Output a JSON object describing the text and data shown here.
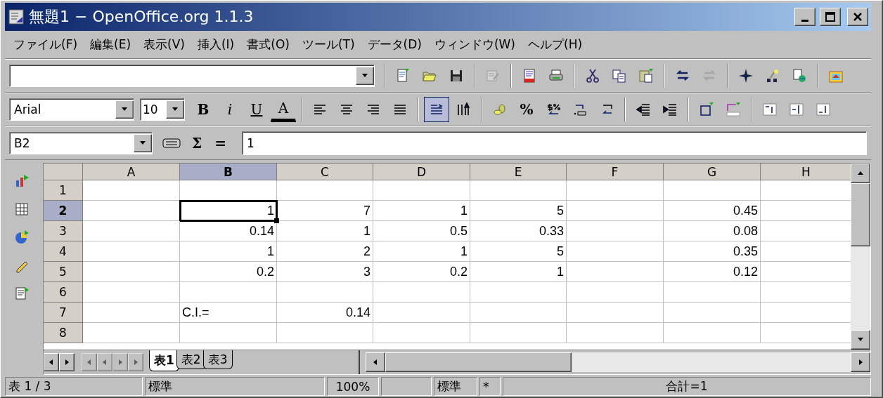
{
  "window": {
    "title": "無題1 − OpenOffice.org 1.1.3"
  },
  "menu": [
    {
      "label": "ファイル(F)"
    },
    {
      "label": "編集(E)"
    },
    {
      "label": "表示(V)"
    },
    {
      "label": "挿入(I)"
    },
    {
      "label": "書式(O)"
    },
    {
      "label": "ツール(T)"
    },
    {
      "label": "データ(D)"
    },
    {
      "label": "ウィンドウ(W)"
    },
    {
      "label": "ヘルプ(H)"
    }
  ],
  "standard_toolbar": {
    "items": [
      {
        "kind": "new-document",
        "disabled": false
      },
      {
        "kind": "open-folder",
        "disabled": false
      },
      {
        "kind": "floppy-disk",
        "disabled": false
      },
      {
        "kind": "separator"
      },
      {
        "kind": "edit-document",
        "disabled": true
      },
      {
        "kind": "separator"
      },
      {
        "kind": "pdf-document",
        "disabled": false
      },
      {
        "kind": "printer",
        "disabled": false
      },
      {
        "kind": "separator"
      },
      {
        "kind": "scissors",
        "disabled": false
      },
      {
        "kind": "copy",
        "disabled": false
      },
      {
        "kind": "paste",
        "disabled": false
      },
      {
        "kind": "separator"
      },
      {
        "kind": "undo-arrow",
        "disabled": false
      },
      {
        "kind": "redo-arrow",
        "disabled": true
      },
      {
        "kind": "separator"
      },
      {
        "kind": "compass-star",
        "disabled": false
      },
      {
        "kind": "stylist",
        "disabled": false
      },
      {
        "kind": "globe-document",
        "disabled": false
      },
      {
        "kind": "separator"
      },
      {
        "kind": "framed-picture",
        "disabled": false
      }
    ]
  },
  "format_toolbar": {
    "font": "Arial",
    "size": "10",
    "items": [
      {
        "kind": "bold",
        "glyph": "B",
        "pressed": false
      },
      {
        "kind": "italic",
        "glyph": "i",
        "pressed": false
      },
      {
        "kind": "underline",
        "glyph": "U",
        "pressed": false
      },
      {
        "kind": "font-color",
        "glyph": "A",
        "pressed": false
      },
      {
        "kind": "separator"
      },
      {
        "kind": "align-left",
        "pressed": false
      },
      {
        "kind": "align-center",
        "pressed": false
      },
      {
        "kind": "align-right",
        "pressed": false
      },
      {
        "kind": "justify",
        "pressed": false
      },
      {
        "kind": "separator"
      },
      {
        "kind": "wrap-text",
        "pressed": true
      },
      {
        "kind": "vertical-text",
        "pressed": false
      },
      {
        "kind": "separator"
      },
      {
        "kind": "coins",
        "pressed": false
      },
      {
        "kind": "percent",
        "glyph": "%",
        "pressed": false
      },
      {
        "kind": "currency-percent",
        "pressed": false
      },
      {
        "kind": "add-decimal",
        "pressed": false
      },
      {
        "kind": "remove-decimal",
        "pressed": false
      },
      {
        "kind": "separator"
      },
      {
        "kind": "outdent",
        "pressed": false
      },
      {
        "kind": "indent",
        "pressed": false
      },
      {
        "kind": "separator"
      },
      {
        "kind": "border",
        "pressed": false
      },
      {
        "kind": "fill-color",
        "pressed": false
      },
      {
        "kind": "separator"
      },
      {
        "kind": "align-top",
        "pressed": false
      },
      {
        "kind": "align-middle",
        "pressed": false
      },
      {
        "kind": "align-bottom",
        "pressed": false
      }
    ]
  },
  "formula_bar": {
    "name_box": "B2",
    "sum": "Σ",
    "equals": "=",
    "value": "1"
  },
  "side_toolbar": [
    {
      "kind": "chart-edit"
    },
    {
      "kind": "grid-table"
    },
    {
      "kind": "pie-chart"
    },
    {
      "kind": "pencil"
    },
    {
      "kind": "document-arrow"
    }
  ],
  "sheet": {
    "columns": [
      {
        "label": "A",
        "selected": false
      },
      {
        "label": "B",
        "selected": true
      },
      {
        "label": "C",
        "selected": false
      },
      {
        "label": "D",
        "selected": false
      },
      {
        "label": "E",
        "selected": false
      },
      {
        "label": "F",
        "selected": false
      },
      {
        "label": "G",
        "selected": false
      },
      {
        "label": "H",
        "selected": false
      }
    ],
    "rows": [
      {
        "header": "1",
        "selected": false,
        "cells": [
          null,
          null,
          null,
          null,
          null,
          null,
          null,
          null
        ]
      },
      {
        "header": "2",
        "selected": true,
        "cells": [
          null,
          {
            "text": "1",
            "kind": "number",
            "selected": true
          },
          {
            "text": "7",
            "kind": "number",
            "selected": false
          },
          {
            "text": "1",
            "kind": "number",
            "selected": false
          },
          {
            "text": "5",
            "kind": "number",
            "selected": false
          },
          null,
          {
            "text": "0.45",
            "kind": "number",
            "selected": false
          },
          null
        ]
      },
      {
        "header": "3",
        "selected": false,
        "cells": [
          null,
          {
            "text": "0.14",
            "kind": "number",
            "selected": false
          },
          {
            "text": "1",
            "kind": "number",
            "selected": false
          },
          {
            "text": "0.5",
            "kind": "number",
            "selected": false
          },
          {
            "text": "0.33",
            "kind": "number",
            "selected": false
          },
          null,
          {
            "text": "0.08",
            "kind": "number",
            "selected": false
          },
          null
        ]
      },
      {
        "header": "4",
        "selected": false,
        "cells": [
          null,
          {
            "text": "1",
            "kind": "number",
            "selected": false
          },
          {
            "text": "2",
            "kind": "number",
            "selected": false
          },
          {
            "text": "1",
            "kind": "number",
            "selected": false
          },
          {
            "text": "5",
            "kind": "number",
            "selected": false
          },
          null,
          {
            "text": "0.35",
            "kind": "number",
            "selected": false
          },
          null
        ]
      },
      {
        "header": "5",
        "selected": false,
        "cells": [
          null,
          {
            "text": "0.2",
            "kind": "number",
            "selected": false
          },
          {
            "text": "3",
            "kind": "number",
            "selected": false
          },
          {
            "text": "0.2",
            "kind": "number",
            "selected": false
          },
          {
            "text": "1",
            "kind": "number",
            "selected": false
          },
          null,
          {
            "text": "0.12",
            "kind": "number",
            "selected": false
          },
          null
        ]
      },
      {
        "header": "6",
        "selected": false,
        "cells": [
          null,
          null,
          null,
          null,
          null,
          null,
          null,
          null
        ]
      },
      {
        "header": "7",
        "selected": false,
        "cells": [
          null,
          {
            "text": "C.I.=",
            "kind": "text",
            "selected": false
          },
          {
            "text": "0.14",
            "kind": "number",
            "selected": false
          },
          null,
          null,
          null,
          null,
          null
        ]
      },
      {
        "header": "8",
        "selected": false,
        "cells": [
          null,
          null,
          null,
          null,
          null,
          null,
          null,
          null
        ]
      }
    ]
  },
  "sheet_tabs": [
    {
      "label": "表1",
      "selected": true
    },
    {
      "label": "表2",
      "selected": false
    },
    {
      "label": "表3",
      "selected": false
    }
  ],
  "status_bar": [
    {
      "text": "表 1 / 3",
      "kind": "left"
    },
    {
      "text": "標準",
      "kind": "left"
    },
    {
      "text": "100%",
      "kind": "center"
    },
    {
      "kind": "empty"
    },
    {
      "text": "標準",
      "kind": "left"
    },
    {
      "text": "*",
      "kind": "left"
    },
    {
      "text": "合計=1",
      "kind": "center"
    }
  ]
}
